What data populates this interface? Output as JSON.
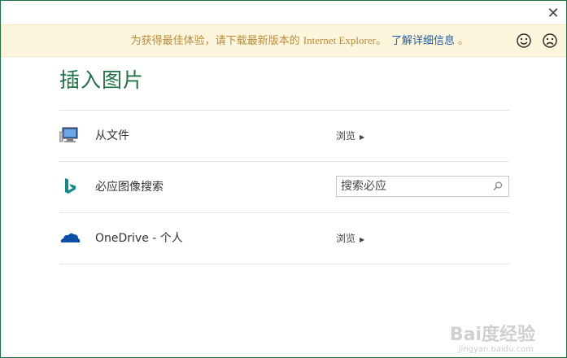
{
  "dialog": {
    "close_glyph": "✕"
  },
  "banner": {
    "text_before": "为获得最佳体验，请下载最新版本的 ",
    "browser_name": "Internet Explorer",
    "text_after": "。",
    "link_text": "了解详细信息",
    "link_suffix": "。",
    "happy_icon": "smile-icon",
    "sad_icon": "frown-icon",
    "text_color": "#b88b3a",
    "link_color": "#1d5fa7"
  },
  "title": "插入图片",
  "accent_color": "#217346",
  "sources": [
    {
      "icon": "computer-icon",
      "label": "从文件",
      "action": "浏览"
    },
    {
      "icon": "bing-icon",
      "label": "必应图像搜索",
      "search_placeholder": "搜索必应"
    },
    {
      "icon": "onedrive-cloud-icon",
      "label": "OneDrive - 个人",
      "action": "浏览"
    }
  ],
  "watermark": {
    "main": "Bai度经验",
    "sub": "jingyan.baidu.com"
  }
}
